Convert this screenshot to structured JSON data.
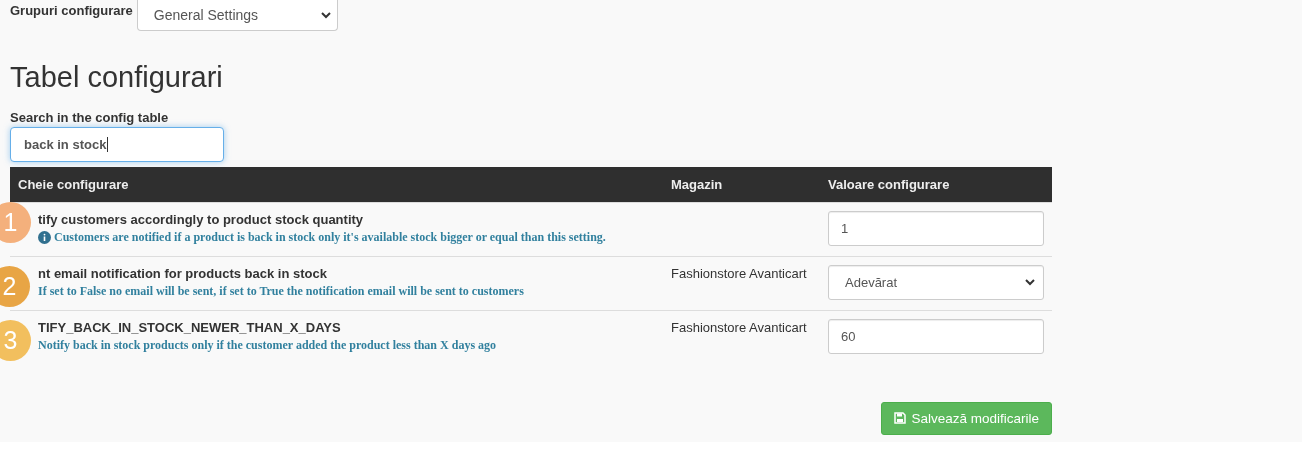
{
  "group_filter": {
    "label": "Grupuri configurare",
    "value": "General Settings"
  },
  "heading": "Tabel configurari",
  "search": {
    "label": "Search in the config table",
    "value": "back in stock"
  },
  "table": {
    "columns": [
      "Cheie configurare",
      "Magazin",
      "Valoare configurare"
    ],
    "rows": [
      {
        "key": "tify customers accordingly to product stock quantity",
        "description": "Customers are notified if a product is back in stock only it's available stock bigger or equal than this setting.",
        "info_icon": true,
        "value": {
          "kind": "input",
          "text": "1"
        }
      },
      {
        "key": "nt email notification for products back in stock",
        "description": "If set to False no email will be sent, if set to True the notification email will be sent to customers",
        "info_icon": false,
        "store": "Fashionstore Avanticart",
        "value": {
          "kind": "select",
          "text": "Adevărat"
        }
      },
      {
        "key": "TIFY_BACK_IN_STOCK_NEWER_THAN_X_DAYS",
        "description": "Notify back in stock products only if the customer added the product less than X days ago",
        "info_icon": false,
        "store": "Fashionstore Avanticart",
        "value": {
          "kind": "input",
          "text": "60"
        }
      }
    ]
  },
  "save_button": "Salvează modificarile",
  "callouts": [
    {
      "number": "1",
      "color": "#f4b07c"
    },
    {
      "number": "2",
      "color": "#e8a545"
    },
    {
      "number": "3",
      "color": "#f2bf5e"
    }
  ]
}
